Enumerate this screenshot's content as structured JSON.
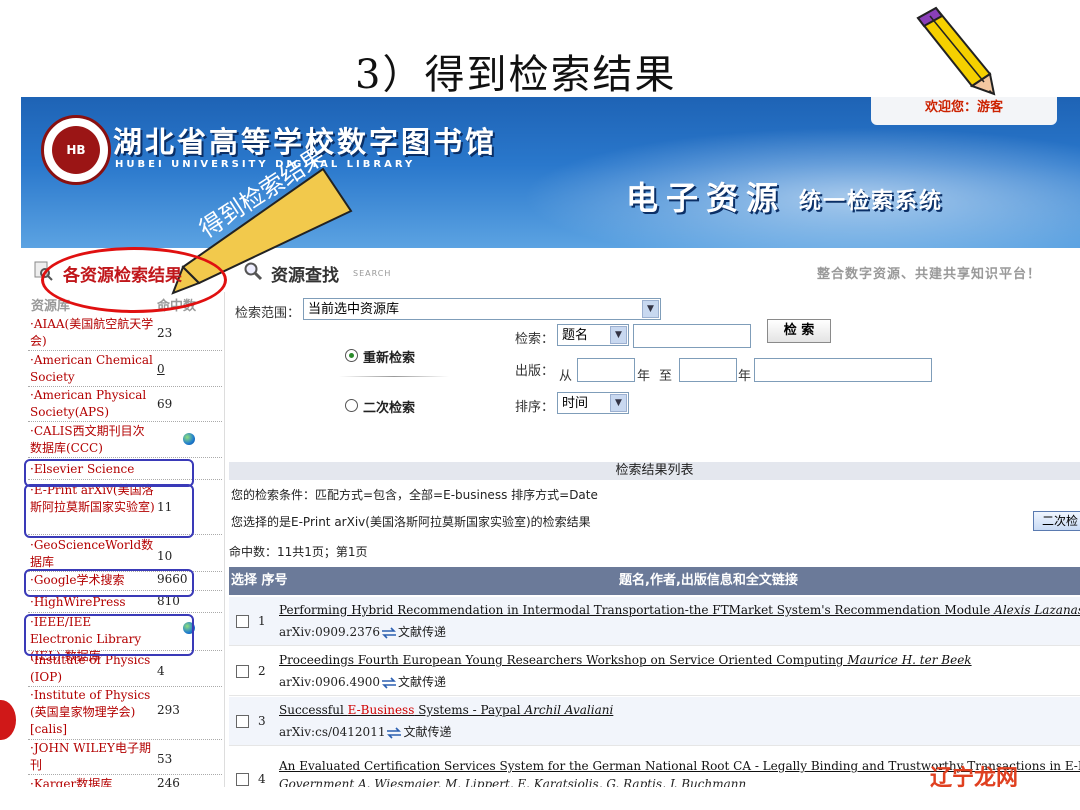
{
  "slide_title": "3）得到检索结果",
  "header": {
    "library_name": "湖北省高等学校数字图书馆",
    "library_name_en": "HUBEI UNIVERSITY DIGITAL LIBRARY",
    "welcome": "欢迎您：游客",
    "system_title_a": "电子资源",
    "system_title_b": "统一检索系统"
  },
  "callout": "得到检索结果",
  "sections": {
    "left_heading": "各资源检索结果",
    "mid_heading": "资源查找",
    "mid_heading_en": "SEARCH",
    "slogan": "整合数字资源、共建共享知识平台！"
  },
  "source_list": {
    "col_source": "资源库",
    "col_hits": "命中数",
    "items": [
      {
        "name": "·AIAA(美国航空航天学会)",
        "count": "23"
      },
      {
        "name": "·American Chemical Society",
        "count": "0"
      },
      {
        "name": "·American Physical Society(APS)",
        "count": "69"
      },
      {
        "name": "·CALIS西文期刊目次数据库(CCC)",
        "count": ""
      },
      {
        "name": "·Elsevier Science",
        "count": ""
      },
      {
        "name": "·E-Print arXiv(美国洛斯阿拉莫斯国家实验室)",
        "count": "11"
      },
      {
        "name": "·GeoScienceWorld数据库",
        "count": "10"
      },
      {
        "name": "·Google学术搜索",
        "count": "9660"
      },
      {
        "name": "·HighWirePress",
        "count": "810"
      },
      {
        "name": "·IEEE/IEE Electronic Library (IEL) 数据库",
        "count": ""
      },
      {
        "name": "·Institute of Physics (IOP)",
        "count": "4"
      },
      {
        "name": "·Institute of Physics (英国皇家物理学会)[calis]",
        "count": "293"
      },
      {
        "name": "·JOHN WILEY电子期刊",
        "count": "53"
      },
      {
        "name": "·Karger数据库",
        "count": "246"
      }
    ]
  },
  "search_form": {
    "scope_label": "检索范围：",
    "scope_value": "当前选中资源库",
    "search_label": "检索：",
    "field_value": "题名",
    "keyword_value": "",
    "search_button": "检 索",
    "publish_label": "出版：",
    "from_label": "从",
    "year_label": "年",
    "to_label": "至",
    "year_label2": "年",
    "sort_label": "排序：",
    "sort_value": "时间",
    "radio_new": "重新检索",
    "radio_secondary": "二次检索"
  },
  "results": {
    "list_title": "检索结果列表",
    "conditions": "您的检索条件：匹配方式=包含，全部=E-business 排序方式=Date",
    "chosen_db": "您选择的是E-Print arXiv(美国洛斯阿拉莫斯国家实验室)的检索结果",
    "secondary_button": "二次检",
    "hit_summary": "命中数：11共1页；第1页",
    "col_select": "选择 序号",
    "col_info": "题名,作者,出版信息和全文链接",
    "delivery_label": "文献传递",
    "rows": [
      {
        "no": "1",
        "title": "Performing Hybrid Recommendation in Intermodal Transportation-the FTMarket System's Recommendation Module",
        "author": "Alexis Lazanas",
        "id": "arXiv:0909.2376"
      },
      {
        "no": "2",
        "title": "Proceedings Fourth European Young Researchers Workshop on Service Oriented Computing",
        "author": "Maurice H. ter Beek",
        "id": "arXiv:0906.4900"
      },
      {
        "no": "3",
        "title_pre": "Successful ",
        "title_hl": "E-Business",
        "title_post": " Systems - Paypal",
        "author": "Archil Avaliani",
        "id": "arXiv:cs/0412011"
      },
      {
        "no": "4",
        "title": "An Evaluated Certification Services System for the German National Root CA - Legally Binding and Trustworthy Transactions in E-Business and E-",
        "line2": "Government A. Wiesmaier, M. Lippert, E. Karatsiolis, G. Raptis, J. Buchmann",
        "id": ""
      }
    ]
  },
  "watermark": "辽宁龙网"
}
